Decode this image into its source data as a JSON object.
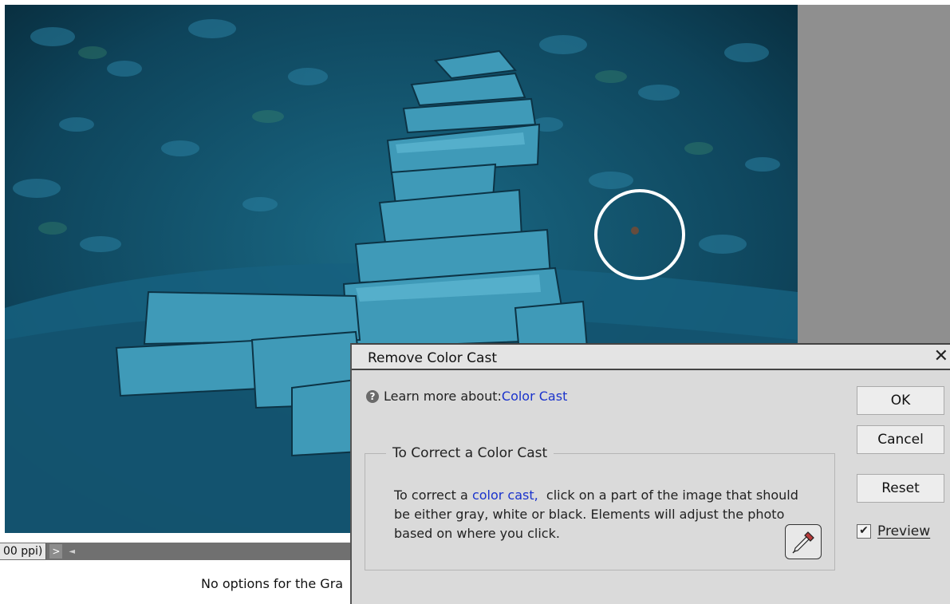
{
  "statusbar": {
    "zoom": "00 ppi)",
    "nav_arrow": ">",
    "scroll_left": "◄"
  },
  "options_bar": {
    "text": "No options for the Gra"
  },
  "dialog": {
    "title": "Remove Color Cast",
    "close": "✕",
    "help_icon": "?",
    "learn_prefix": "Learn more about: ",
    "learn_link": "Color Cast",
    "group_title": "To Correct a Color Cast",
    "body_prefix": "To correct a ",
    "body_link": "color cast,",
    "body_rest": "  click on a part of the image that should be either gray, white or black. Elements will adjust the photo based on where you click.",
    "ok": "OK",
    "cancel": "Cancel",
    "reset": "Reset",
    "preview_label": "Preview",
    "preview_checked": true,
    "checkmark": "✔"
  },
  "colors": {
    "photo_base": "#0d3a4e",
    "link": "#1a33cc",
    "dialog_bg": "#dadada"
  },
  "icons": [
    "help-icon",
    "close-icon",
    "eyedropper-icon",
    "checkbox-icon"
  ]
}
